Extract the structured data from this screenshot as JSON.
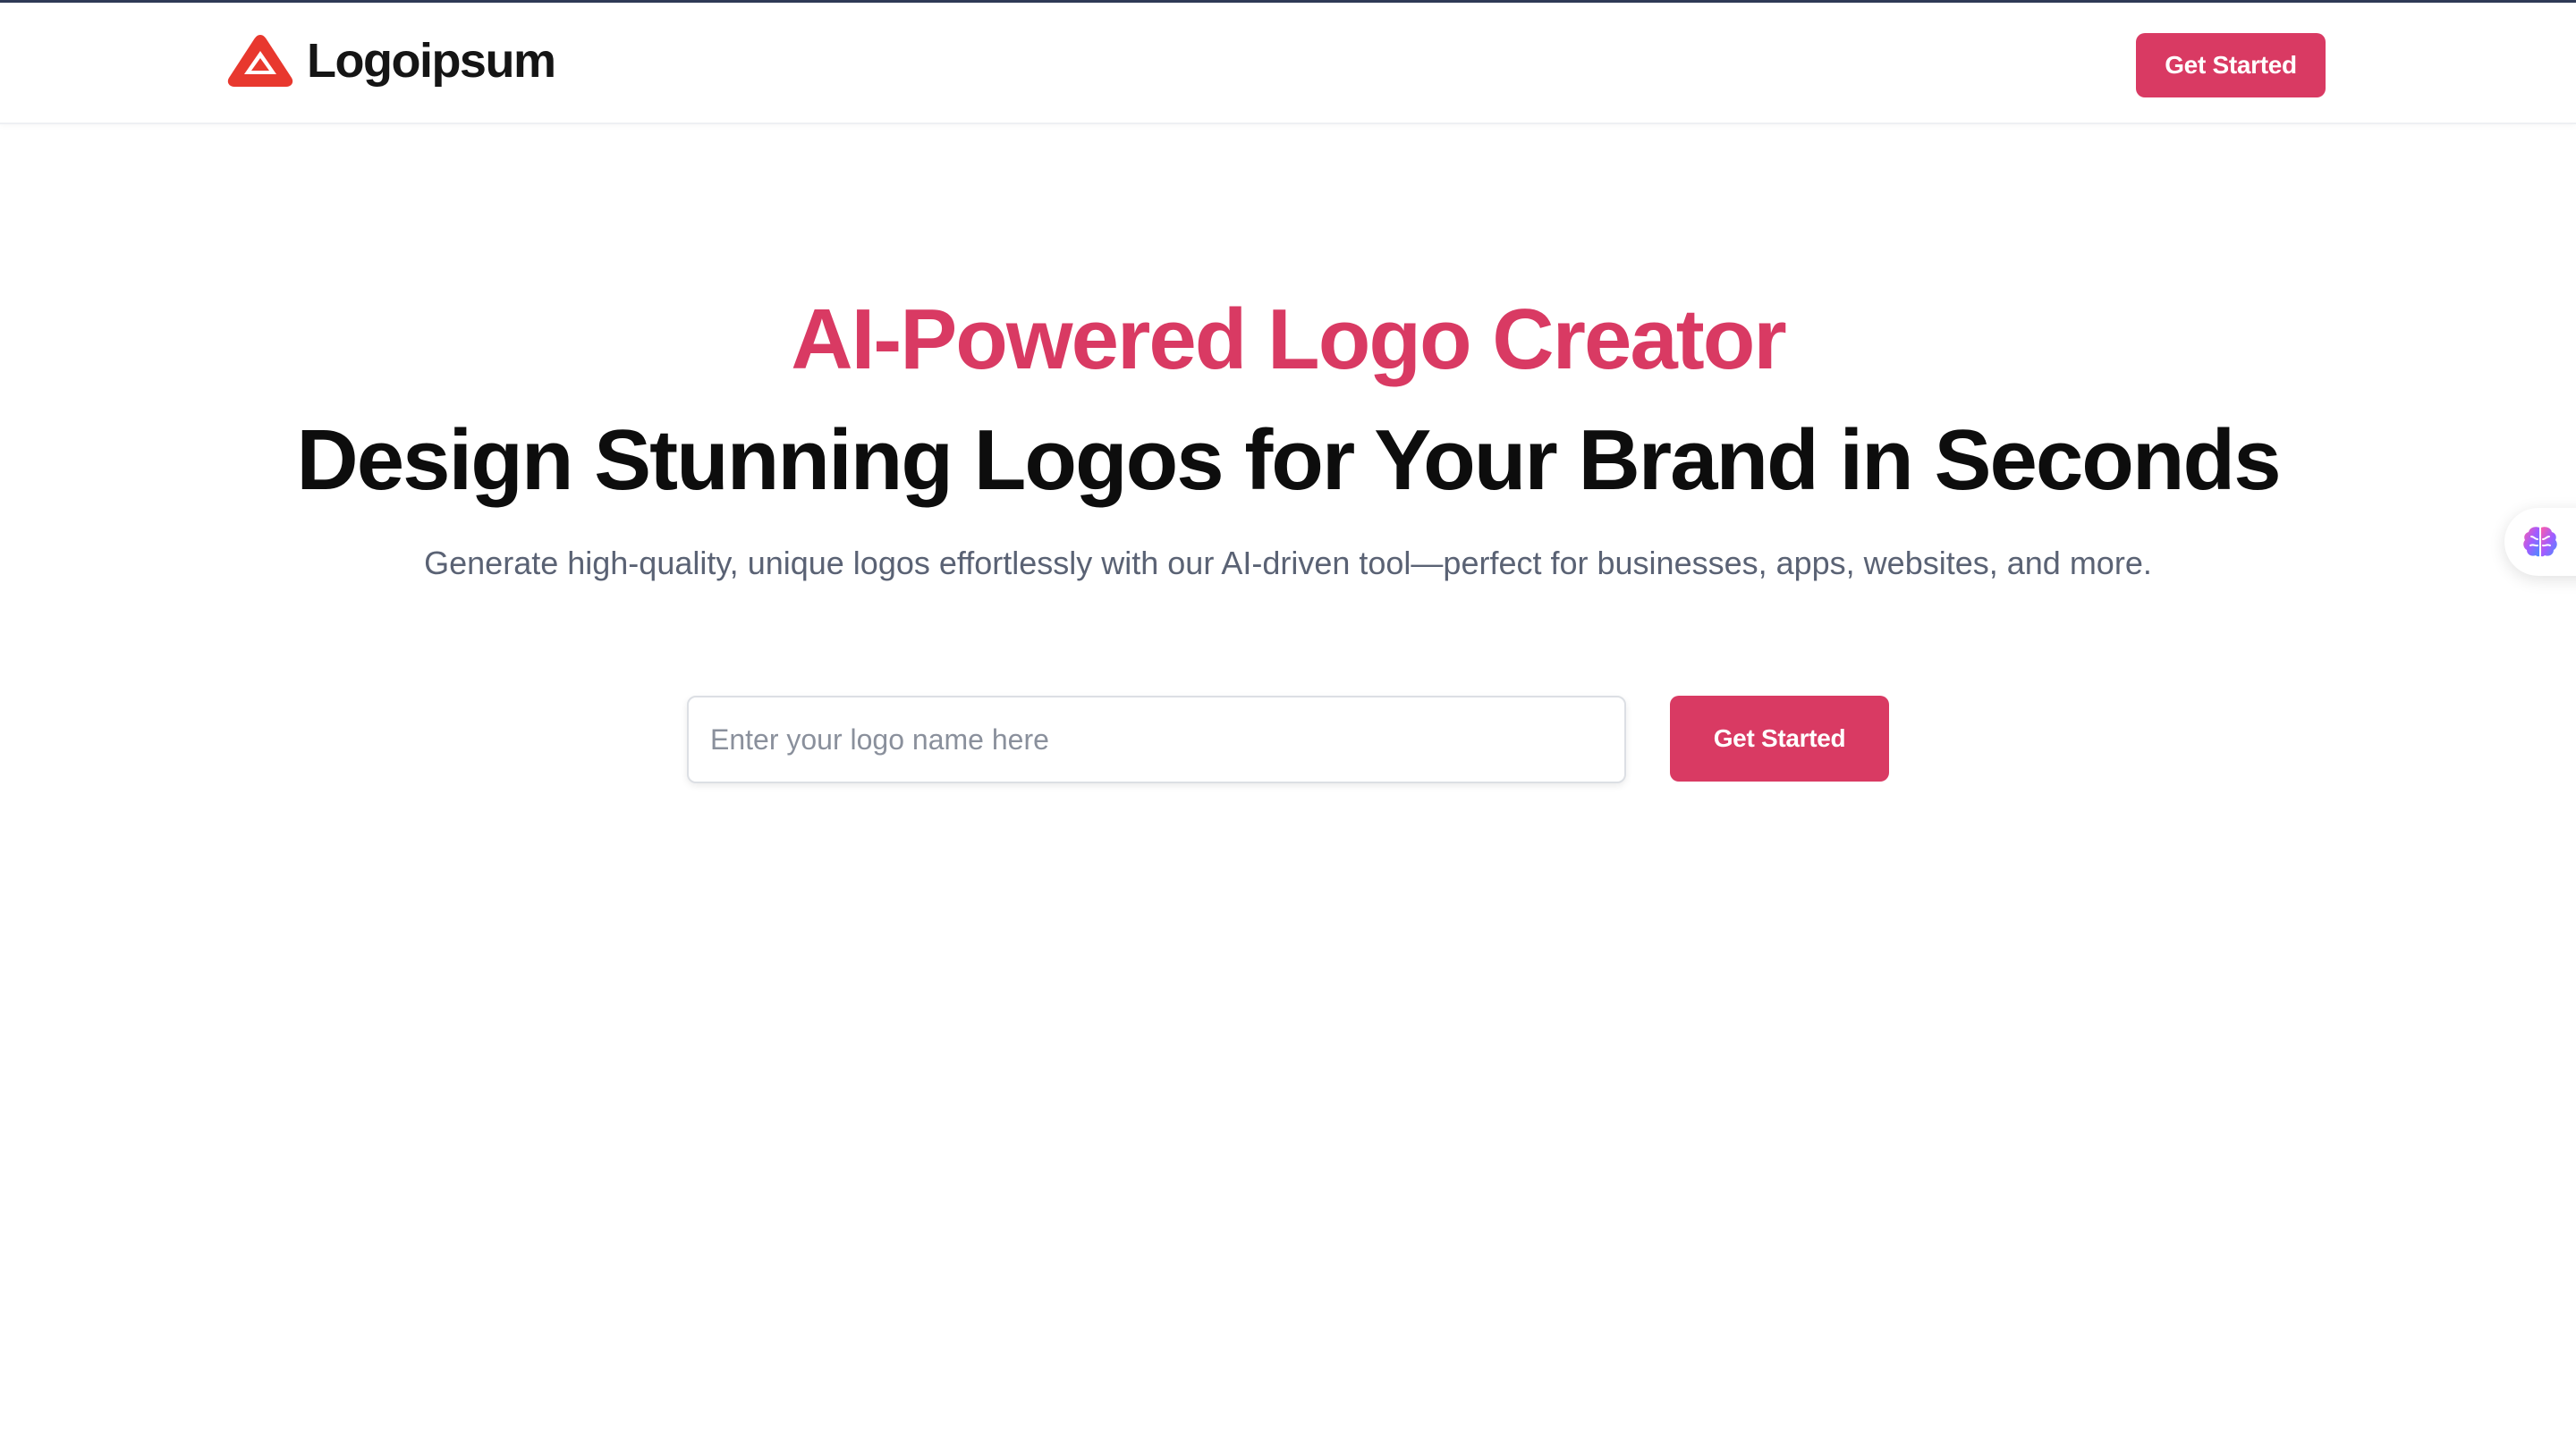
{
  "brand": {
    "name": "Logoipsum",
    "logo_icon": "triangle-logo-icon",
    "logo_color": "#e8382e"
  },
  "nav": {
    "cta_label": "Get Started"
  },
  "hero": {
    "eyebrow": "AI-Powered Logo Creator",
    "title": "Design Stunning Logos for Your Brand in Seconds",
    "subtitle": "Generate high-quality, unique logos effortlessly with our AI-driven tool—perfect for businesses, apps, websites, and more.",
    "input_placeholder": "Enter your logo name here",
    "input_value": "",
    "cta_label": "Get Started"
  },
  "widget": {
    "icon": "brain-icon"
  },
  "colors": {
    "accent": "#d93a63",
    "heading": "#0d0d0d",
    "muted": "#5a6274",
    "top_border": "#2f3a56"
  }
}
